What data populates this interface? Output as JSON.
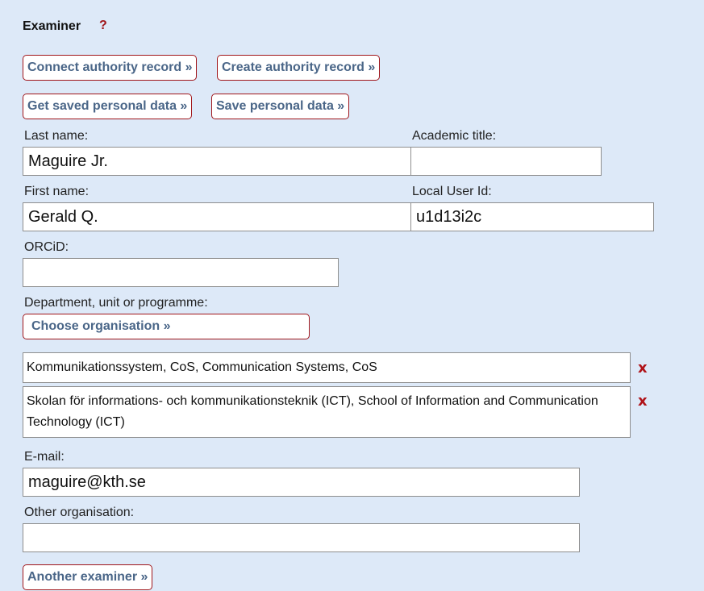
{
  "examiner": {
    "heading": "Examiner",
    "help": "?",
    "buttons": {
      "connect_authority": "Connect authority record »",
      "create_authority": "Create authority record »",
      "get_saved": "Get saved personal data »",
      "save_personal": "Save personal data »",
      "choose_org": "Choose organisation »",
      "another_examiner": "Another examiner »"
    },
    "fields": {
      "last_name": {
        "label": "Last name:",
        "value": "Maguire Jr."
      },
      "academic_title": {
        "label": "Academic title:",
        "value": ""
      },
      "first_name": {
        "label": "First name:",
        "value": "Gerald Q."
      },
      "local_user_id": {
        "label": "Local User Id:",
        "value": "u1d13i2c"
      },
      "orcid": {
        "label": "ORCiD:",
        "value": ""
      },
      "department": {
        "label": "Department, unit or programme:"
      },
      "email": {
        "label": "E-mail:",
        "value": "maguire@kth.se"
      },
      "other_org": {
        "label": "Other organisation:",
        "value": ""
      }
    },
    "organisations": [
      {
        "name": "Kommunikationssystem, CoS, Communication Systems, CoS",
        "remove": "x"
      },
      {
        "name": "Skolan för informations- och kommunikationsteknik (ICT), School of Information and Communication Technology (ICT)",
        "remove": "x"
      }
    ],
    "remove_icon": "x-remove-icon"
  }
}
